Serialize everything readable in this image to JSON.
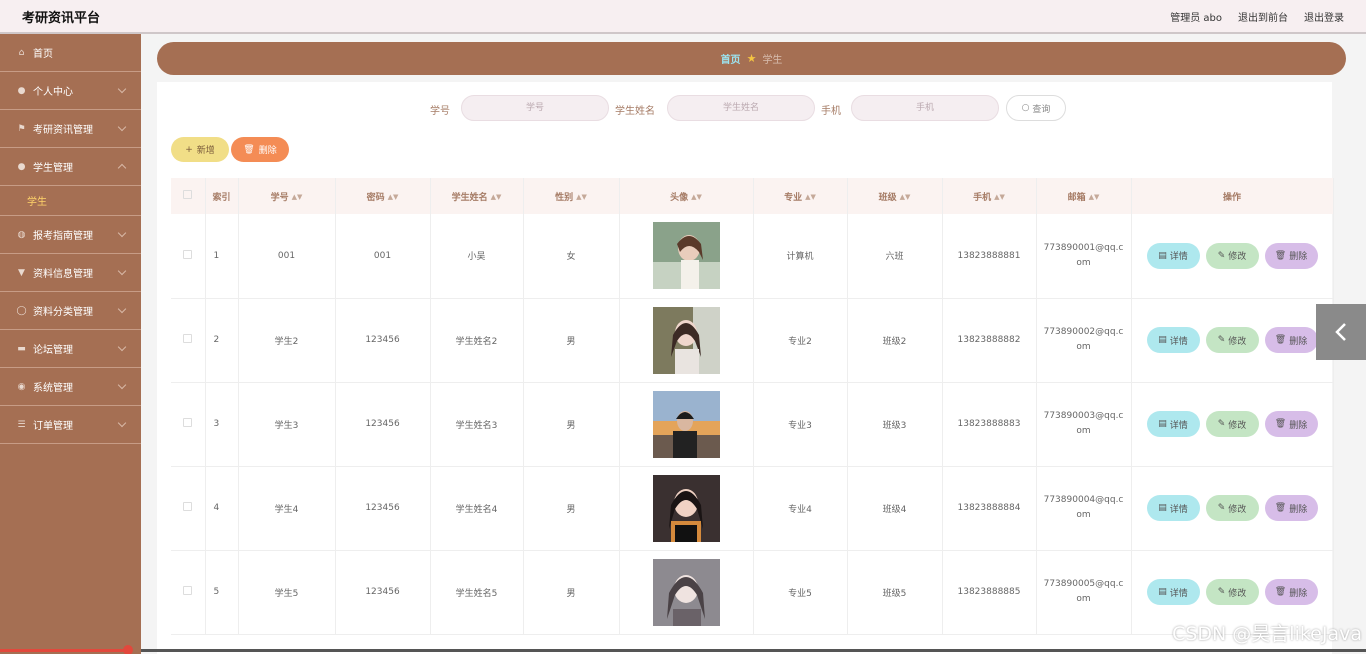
{
  "app": {
    "title": "考研资讯平台"
  },
  "header": {
    "user": "管理员 abo",
    "frontend": "退出到前台",
    "logout": "退出登录"
  },
  "sidebar": {
    "items": [
      {
        "label": "首页",
        "icon": "home-icon",
        "glyph": "⌂"
      },
      {
        "label": "个人中心",
        "icon": "user-icon",
        "glyph": "●"
      },
      {
        "label": "考研资讯管理",
        "icon": "flag-icon",
        "glyph": "⚑"
      },
      {
        "label": "学生管理",
        "icon": "person-icon",
        "glyph": "●"
      },
      {
        "label": "报考指南管理",
        "icon": "mic-icon",
        "glyph": "◍"
      },
      {
        "label": "资料信息管理",
        "icon": "trophy-icon",
        "glyph": "▼"
      },
      {
        "label": "资料分类管理",
        "icon": "refresh-icon",
        "glyph": "◯"
      },
      {
        "label": "论坛管理",
        "icon": "monitor-icon",
        "glyph": "▬"
      },
      {
        "label": "系统管理",
        "icon": "globe-icon",
        "glyph": "◉"
      },
      {
        "label": "订单管理",
        "icon": "sliders-icon",
        "glyph": "☰"
      }
    ],
    "sub_item": "学生"
  },
  "breadcrumb": {
    "home": "首页",
    "current": "学生"
  },
  "search": {
    "fields": [
      {
        "label": "学号",
        "placeholder": "学号"
      },
      {
        "label": "学生姓名",
        "placeholder": "学生姓名"
      },
      {
        "label": "手机",
        "placeholder": "手机"
      }
    ],
    "button": "查询"
  },
  "actions": {
    "add": "新增",
    "delete": "删除"
  },
  "table": {
    "columns": [
      "索引",
      "学号",
      "密码",
      "学生姓名",
      "性别",
      "头像",
      "专业",
      "班级",
      "手机",
      "邮箱",
      "操作"
    ],
    "rows": [
      {
        "index": "1",
        "sid": "001",
        "pwd": "001",
        "name": "小吴",
        "gender": "女",
        "major": "计算机",
        "cls": "六班",
        "phone": "13823888881",
        "email": "773890001@qq.com"
      },
      {
        "index": "2",
        "sid": "学生2",
        "pwd": "123456",
        "name": "学生姓名2",
        "gender": "男",
        "major": "专业2",
        "cls": "班级2",
        "phone": "13823888882",
        "email": "773890002@qq.com"
      },
      {
        "index": "3",
        "sid": "学生3",
        "pwd": "123456",
        "name": "学生姓名3",
        "gender": "男",
        "major": "专业3",
        "cls": "班级3",
        "phone": "13823888883",
        "email": "773890003@qq.com"
      },
      {
        "index": "4",
        "sid": "学生4",
        "pwd": "123456",
        "name": "学生姓名4",
        "gender": "男",
        "major": "专业4",
        "cls": "班级4",
        "phone": "13823888884",
        "email": "773890004@qq.com"
      },
      {
        "index": "5",
        "sid": "学生5",
        "pwd": "123456",
        "name": "学生姓名5",
        "gender": "男",
        "major": "专业5",
        "cls": "班级5",
        "phone": "13823888885",
        "email": "773890005@qq.com"
      }
    ],
    "ops": {
      "detail": "详情",
      "edit": "修改",
      "delete": "删除"
    }
  },
  "watermark": "CSDN @昊言likeJava"
}
